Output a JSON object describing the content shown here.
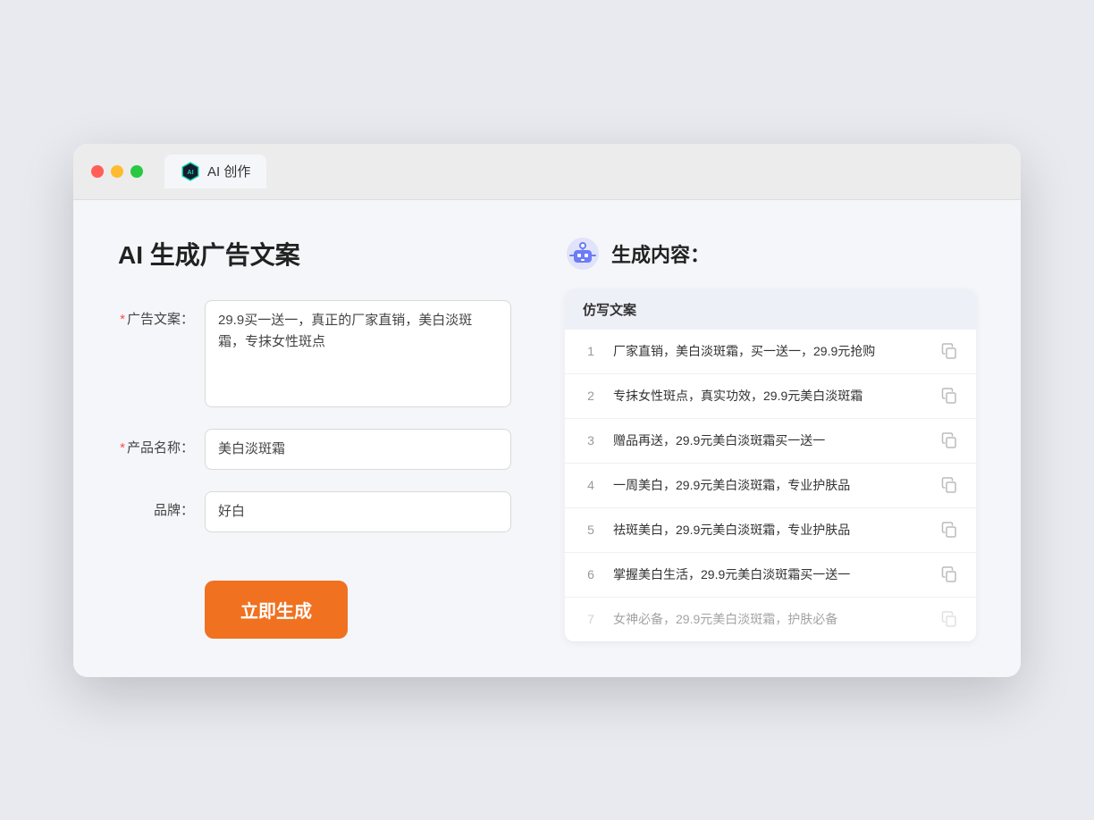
{
  "browser": {
    "tab_label": "AI 创作"
  },
  "page": {
    "title": "AI 生成广告文案",
    "result_title": "生成内容："
  },
  "form": {
    "ad_copy_label": "广告文案：",
    "ad_copy_value": "29.9买一送一，真正的厂家直销，美白淡斑霜，专抹女性斑点",
    "product_name_label": "产品名称：",
    "product_name_value": "美白淡斑霜",
    "brand_label": "品牌：",
    "brand_value": "好白",
    "generate_button": "立即生成"
  },
  "results": {
    "table_header": "仿写文案",
    "rows": [
      {
        "id": 1,
        "text": "厂家直销，美白淡斑霜，买一送一，29.9元抢购",
        "faded": false
      },
      {
        "id": 2,
        "text": "专抹女性斑点，真实功效，29.9元美白淡斑霜",
        "faded": false
      },
      {
        "id": 3,
        "text": "赠品再送，29.9元美白淡斑霜买一送一",
        "faded": false
      },
      {
        "id": 4,
        "text": "一周美白，29.9元美白淡斑霜，专业护肤品",
        "faded": false
      },
      {
        "id": 5,
        "text": "祛斑美白，29.9元美白淡斑霜，专业护肤品",
        "faded": false
      },
      {
        "id": 6,
        "text": "掌握美白生活，29.9元美白淡斑霜买一送一",
        "faded": false
      },
      {
        "id": 7,
        "text": "女神必备，29.9元美白淡斑霜，护肤必备",
        "faded": true
      }
    ]
  }
}
